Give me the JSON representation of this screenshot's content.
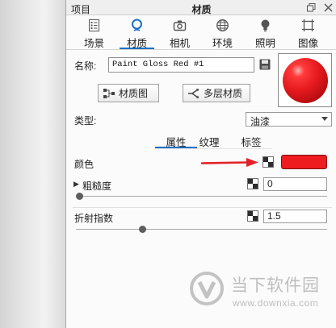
{
  "titlebar": {
    "left_title": "项目",
    "title": "材质",
    "restore_icon": "restore-icon",
    "close_icon": "close-icon"
  },
  "tabs": [
    {
      "label": "场景",
      "icon": "scene-icon",
      "active": false
    },
    {
      "label": "材质",
      "icon": "material-icon",
      "active": true
    },
    {
      "label": "相机",
      "icon": "camera-icon",
      "active": false
    },
    {
      "label": "环境",
      "icon": "globe-icon",
      "active": false
    },
    {
      "label": "照明",
      "icon": "lightbulb-icon",
      "active": false
    },
    {
      "label": "图像",
      "icon": "image-frame-icon",
      "active": false
    }
  ],
  "material": {
    "name_label": "名称:",
    "name_value": "Paint Gloss Red #1",
    "save_icon": "save-icon",
    "preview_icon": "red-sphere-preview"
  },
  "buttons": {
    "material_graph": {
      "label": "材质图",
      "icon": "node-graph-icon"
    },
    "multi_layer": {
      "label": "多层材质",
      "icon": "branch-icon"
    }
  },
  "type": {
    "label": "类型:",
    "value": "油漆",
    "dropdown_icon": "chevron-down-icon"
  },
  "subtabs": [
    {
      "label": "属性",
      "active": true
    },
    {
      "label": "纹理",
      "active": false
    },
    {
      "label": "标签",
      "active": false
    }
  ],
  "properties": {
    "color": {
      "label": "颜色",
      "swatch_color": "#ee1b1f",
      "texture_icon": "checker-icon"
    },
    "roughness": {
      "label": "粗糙度",
      "expand_icon": "triangle-right-icon",
      "value": "0",
      "slider_fraction": 0,
      "texture_icon": "checker-icon"
    },
    "refraction_index": {
      "label": "折射指数",
      "value": "1.5",
      "slider_fraction": 0.26,
      "texture_icon": "checker-icon"
    }
  },
  "annotation": {
    "arrow_color": "#e32227"
  },
  "watermark": {
    "name": "当下软件园",
    "url": "www.downxia.com"
  },
  "colors": {
    "accent": "#1b6fc4"
  }
}
